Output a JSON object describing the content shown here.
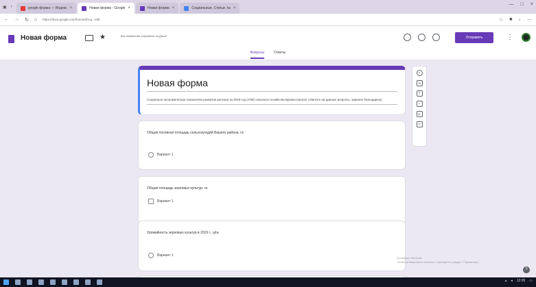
{
  "browser": {
    "tabs": [
      {
        "label": "google форма — Яндекс",
        "color": "#e53935",
        "active": false
      },
      {
        "label": "Новая форма - Google",
        "color": "#673ab7",
        "active": true
      },
      {
        "label": "Новая форма",
        "color": "#673ab7",
        "active": false
      },
      {
        "label": "Социальные. Статьи. №",
        "color": "#4285f4",
        "active": false
      }
    ],
    "url": "https://docs.google.com/forms/d/1cq...edit"
  },
  "header": {
    "form_title": "Новая форма",
    "saved_note": "Все изменения сохранены на Диске",
    "send_label": "Отправить",
    "tabs": [
      {
        "label": "Вопросы",
        "active": true
      },
      {
        "label": "Ответы",
        "active": false
      }
    ]
  },
  "form": {
    "title": "Новая форма",
    "description": "Социально-экономические показатели развития региона за 2019 год (АПК) сельского хозяйства Брянки (просит ответить на данные вопросы, заранее благодарны)",
    "questions": [
      {
        "text": "Общая посевная площадь сельхозугодий Вашего района, га",
        "option": "Вариант 1",
        "type": "radio"
      },
      {
        "text": "Общая площадь зерновых культур, га",
        "option": "Вариант 1",
        "type": "checkbox"
      },
      {
        "text": "Урожайность зерновых культур в 2019 г., ц/га",
        "option": "Вариант 1",
        "type": "radio"
      }
    ]
  },
  "toolbar_icons": [
    "add-question-icon",
    "import-icon",
    "title-text-icon",
    "image-icon",
    "video-icon",
    "section-icon"
  ],
  "watermark": {
    "line1": "Активация Windows",
    "line2": "Чтобы активировать Windows, перейдите в раздел \"Параметры\"."
  },
  "taskbar": {
    "time": "12:05"
  }
}
